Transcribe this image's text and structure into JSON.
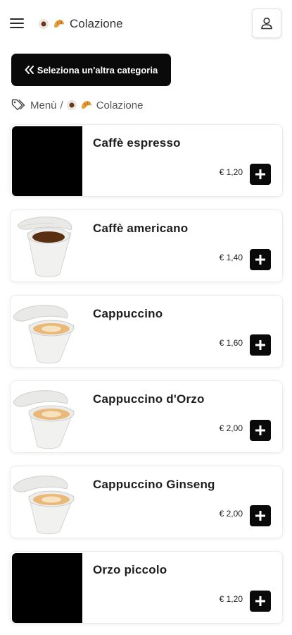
{
  "header": {
    "title": "Colazione",
    "menu_icon": "hamburger-menu-icon",
    "account_icon": "user-icon"
  },
  "back_button": {
    "icon": "double-chevron-left-icon",
    "label": "Seleziona un'altra categoria"
  },
  "breadcrumb": {
    "icon": "tags-icon",
    "root": "Menù",
    "separator": "/",
    "current": "Colazione"
  },
  "category_icons": [
    "coffee-cup-icon",
    "croissant-icon"
  ],
  "products": [
    {
      "name": "Caffè espresso",
      "price": "€ 1,20",
      "image": "placeholder-black"
    },
    {
      "name": "Caffè americano",
      "price": "€ 1,40",
      "image": "americano-cup"
    },
    {
      "name": "Cappuccino",
      "price": "€ 1,60",
      "image": "cappuccino-cup"
    },
    {
      "name": "Cappuccino d'Orzo",
      "price": "€ 2,00",
      "image": "cappuccino-cup"
    },
    {
      "name": "Cappuccino Ginseng",
      "price": "€ 2,00",
      "image": "cappuccino-cup"
    },
    {
      "name": "Orzo piccolo",
      "price": "€ 1,20",
      "image": "placeholder-black"
    }
  ],
  "colors": {
    "button_bg": "#0a0a0a",
    "card_border": "#ececec",
    "background": "#ffffff"
  }
}
